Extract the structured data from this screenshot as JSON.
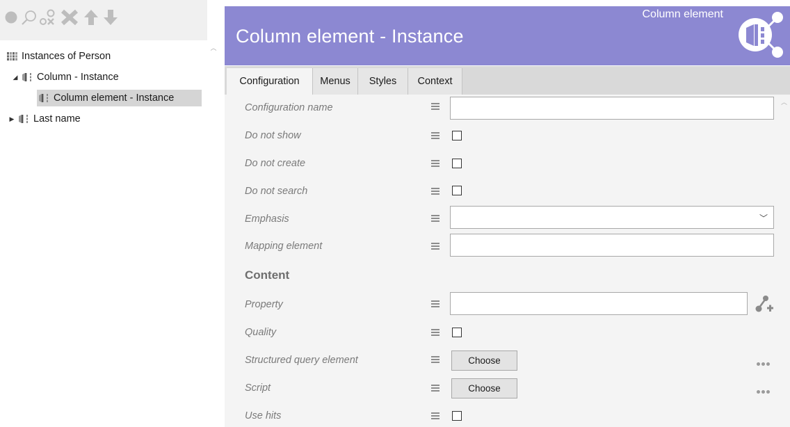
{
  "window": {
    "header_title": "Column element - Instance",
    "header_type": "Column element"
  },
  "toolbar": {
    "buttons": [
      "circle-icon",
      "search-icon",
      "find-replace-icon",
      "delete-icon",
      "move-up-icon",
      "move-down-icon"
    ]
  },
  "tree": {
    "items": [
      {
        "label": "Instances of Person",
        "icon": "instances-icon"
      },
      {
        "label": "Column - Instance",
        "icon": "column-icon",
        "expanded": true
      },
      {
        "label": "Column element - Instance",
        "icon": "column-element-icon",
        "selected": true
      },
      {
        "label": "Last name",
        "icon": "column-icon",
        "expanded": false
      }
    ]
  },
  "tabs": [
    {
      "label": "Configuration",
      "active": true
    },
    {
      "label": "Menus"
    },
    {
      "label": "Styles"
    },
    {
      "label": "Context"
    }
  ],
  "form": {
    "configuration_name": {
      "label": "Configuration name",
      "value": ""
    },
    "do_not_show": {
      "label": "Do not show",
      "checked": false
    },
    "do_not_create": {
      "label": "Do not create",
      "checked": false
    },
    "do_not_search": {
      "label": "Do not search",
      "checked": false
    },
    "emphasis": {
      "label": "Emphasis",
      "value": ""
    },
    "mapping_element": {
      "label": "Mapping element",
      "value": ""
    },
    "content_heading": "Content",
    "property": {
      "label": "Property",
      "value": ""
    },
    "quality": {
      "label": "Quality",
      "checked": false
    },
    "structured_query_element": {
      "label": "Structured query element",
      "button": "Choose"
    },
    "script": {
      "label": "Script",
      "button": "Choose"
    },
    "use_hits": {
      "label": "Use hits",
      "checked": false
    }
  },
  "colors": {
    "header_bg": "#8c88d2",
    "form_bg": "#f4f4f4",
    "tabbar_bg": "#d9d9d9"
  }
}
